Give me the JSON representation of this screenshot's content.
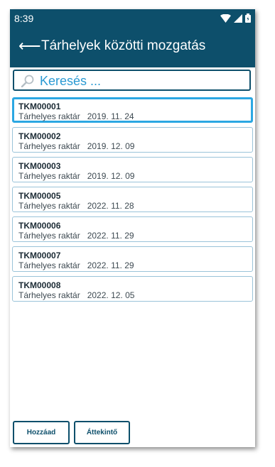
{
  "status": {
    "time": "8:39"
  },
  "header": {
    "title": "Tárhelyek közötti mozgatás",
    "back_glyph": "⟵"
  },
  "search": {
    "placeholder": "Keresés ..."
  },
  "items": [
    {
      "code": "TKM00001",
      "type": "Tárhelyes raktár",
      "date": "2019. 11. 24",
      "selected": true
    },
    {
      "code": "TKM00002",
      "type": "Tárhelyes raktár",
      "date": "2019. 12. 09"
    },
    {
      "code": "TKM00003",
      "type": "Tárhelyes raktár",
      "date": "2019. 12. 09"
    },
    {
      "code": "TKM00005",
      "type": "Tárhelyes raktár",
      "date": "2022. 11. 28"
    },
    {
      "code": "TKM00006",
      "type": "Tárhelyes raktár",
      "date": "2022. 11. 29"
    },
    {
      "code": "TKM00007",
      "type": "Tárhelyes raktár",
      "date": "2022. 11. 29"
    },
    {
      "code": "TKM00008",
      "type": "Tárhelyes raktár",
      "date": "2022. 12. 05"
    }
  ],
  "buttons": {
    "add": "Hozzáad",
    "overview": "Áttekintő"
  },
  "colors": {
    "primary": "#0d4f6b",
    "accent": "#2ba7e2",
    "search_text": "#2a9ad3"
  }
}
